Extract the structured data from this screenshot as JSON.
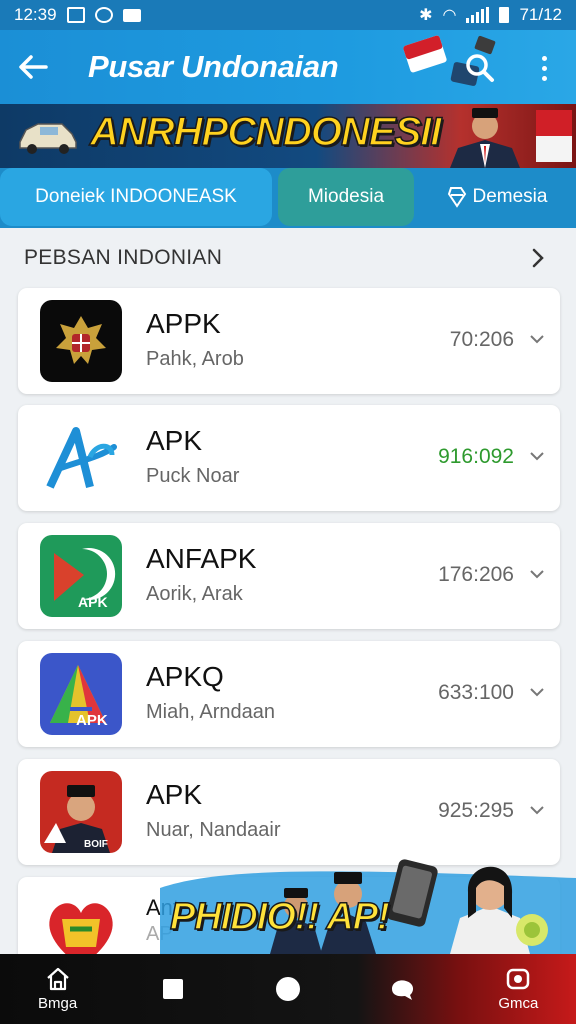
{
  "status_bar": {
    "time": "12:39",
    "battery": "71/12"
  },
  "app_bar": {
    "title": "Pusar Undonaian"
  },
  "banner": {
    "headline": "ANRHPCNDONESII"
  },
  "tabs": [
    {
      "label": "Doneiek  INDOONEASK"
    },
    {
      "label": "Miodesia"
    },
    {
      "label": "Demesia"
    }
  ],
  "section": {
    "title": "PEBSAN INDONIAN"
  },
  "apps": [
    {
      "name": "APPK",
      "subtitle": "Pahk, Arob",
      "value": "70:206",
      "value_color": "#666666",
      "icon": "garuda-emblem-icon"
    },
    {
      "name": "APK",
      "subtitle": "Puck Noar",
      "value": "916:092",
      "value_color": "#2e9a2e",
      "icon": "blue-a-logo-icon"
    },
    {
      "name": "ANFAPK",
      "subtitle": "Aorik, Arak",
      "value": "176:206",
      "value_color": "#666666",
      "icon": "green-apk-icon"
    },
    {
      "name": "APKQ",
      "subtitle": "Miah, Arndaan",
      "value": "633:100",
      "value_color": "#666666",
      "icon": "rainbow-apk-icon"
    },
    {
      "name": "APK",
      "subtitle": "Nuar, Nandaair",
      "value": "925:295",
      "value_color": "#666666",
      "icon": "portrait-apk-icon"
    },
    {
      "name": "Ant",
      "subtitle": "AP",
      "value": "",
      "value_color": "#666666",
      "icon": "heart-logo-icon"
    }
  ],
  "promo": {
    "text": "PHIDIO!! AP!"
  },
  "nav": [
    {
      "label": "Bmga",
      "icon": "home-icon"
    },
    {
      "label": "",
      "icon": "square-icon"
    },
    {
      "label": "",
      "icon": "circle-icon"
    },
    {
      "label": "",
      "icon": "chat-icon"
    },
    {
      "label": "Gmca",
      "icon": "camera-icon"
    }
  ]
}
